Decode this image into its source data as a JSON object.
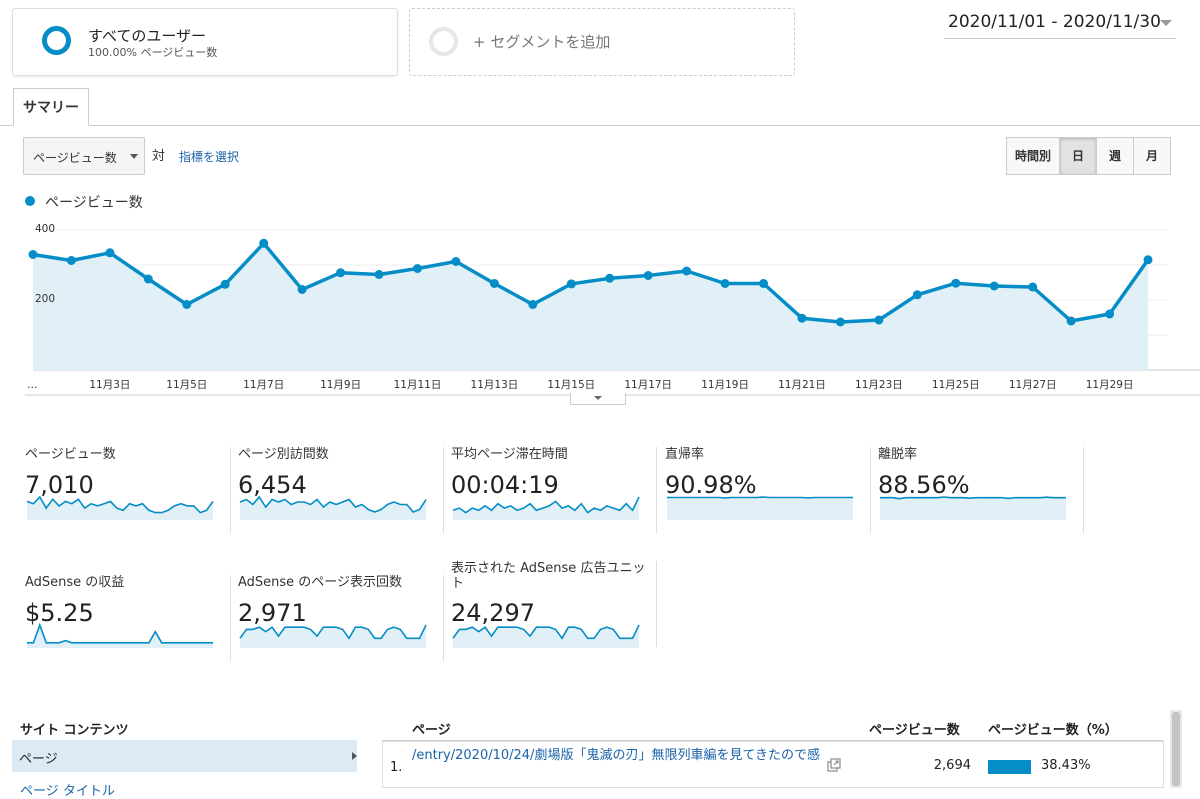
{
  "segments": {
    "all_users": {
      "title": "すべてのユーザー",
      "subtitle": "100.00% ページビュー数"
    },
    "add_label": "+ セグメントを追加"
  },
  "date_range": "2020/11/01 - 2020/11/30",
  "tab": "サマリー",
  "controls": {
    "metric": "ページビュー数",
    "vs": "対",
    "pick_metric": "指標を選択",
    "granularity": [
      "時間別",
      "日",
      "週",
      "月"
    ],
    "selected_granularity": "日"
  },
  "colors": {
    "accent": "#058dc7",
    "fill": "#e1eff7",
    "link": "#1a62a8"
  },
  "chart_data": {
    "type": "area",
    "series": [
      {
        "name": "ページビュー数",
        "values": [
          330,
          313,
          335,
          260,
          187,
          245,
          362,
          230,
          278,
          273,
          290,
          310,
          247,
          187,
          246,
          262,
          270,
          283,
          247,
          247,
          148,
          137,
          143,
          215,
          248,
          240,
          237,
          140,
          160,
          315
        ]
      }
    ],
    "x_tick_labels": [
      "…",
      "11月3日",
      "11月5日",
      "11月7日",
      "11月9日",
      "11月11日",
      "11月13日",
      "11月15日",
      "11月17日",
      "11月19日",
      "11月21日",
      "11月23日",
      "11月25日",
      "11月27日",
      "11月29日"
    ],
    "y_tick_labels": [
      "400",
      "200"
    ],
    "ylim": [
      0,
      400
    ],
    "grid": true
  },
  "cards": [
    {
      "label": "ページビュー数",
      "value": "7,010",
      "spark": [
        7,
        6,
        9,
        4,
        8,
        5,
        7,
        6,
        8,
        4,
        6,
        5,
        6,
        7,
        4,
        3,
        6,
        5,
        6,
        3,
        2,
        2,
        3,
        5,
        6,
        5,
        5,
        2,
        3,
        7
      ]
    },
    {
      "label": "ページ別訪問数",
      "value": "6,454",
      "spark": [
        6,
        7,
        5,
        8,
        4,
        7,
        6,
        7,
        5,
        6,
        6,
        5,
        7,
        4,
        6,
        5,
        6,
        7,
        4,
        5,
        3,
        2,
        3,
        5,
        6,
        5,
        5,
        2,
        3,
        7
      ]
    },
    {
      "label": "平均ページ滞在時間",
      "value": "00:04:19",
      "spark": [
        3,
        4,
        2,
        4,
        3,
        5,
        3,
        6,
        4,
        5,
        3,
        4,
        6,
        3,
        4,
        5,
        7,
        4,
        5,
        3,
        6,
        2,
        4,
        3,
        5,
        4,
        3,
        6,
        3,
        9
      ]
    },
    {
      "label": "直帰率",
      "value": "90.98%",
      "spark": [
        8,
        8,
        8,
        8,
        8,
        8,
        8,
        8,
        8,
        7.8,
        8,
        8,
        8,
        8,
        8,
        8.2,
        8,
        8,
        8,
        8,
        8,
        8,
        7.8,
        8,
        8,
        8,
        8,
        8,
        8,
        8
      ]
    },
    {
      "label": "離脱率",
      "value": "88.56%",
      "spark": [
        8,
        8,
        8,
        7.6,
        8,
        8,
        8,
        8,
        8,
        8,
        8.3,
        8,
        8,
        8,
        7.8,
        8,
        8,
        8,
        8,
        8,
        7.7,
        8,
        8,
        8,
        8,
        8,
        8.2,
        8,
        8,
        8
      ]
    },
    {
      "label": "AdSense の収益",
      "value": "$5.25",
      "spark": [
        1,
        1,
        9,
        1,
        1,
        1,
        2,
        1,
        1,
        1,
        1,
        1,
        1,
        1,
        1,
        1,
        1,
        1,
        1,
        1,
        6,
        1,
        1,
        1,
        1,
        1,
        1,
        1,
        1,
        1
      ]
    },
    {
      "label": "AdSense のページ表示回数",
      "value": "2,971",
      "spark": [
        3,
        7,
        7,
        8,
        6,
        8,
        4,
        8,
        8,
        8,
        8,
        7,
        4,
        8,
        8,
        8,
        7,
        3,
        8,
        8,
        7,
        3,
        3,
        7,
        8,
        7,
        3,
        3,
        3,
        9
      ]
    },
    {
      "label": "表示された AdSense 広告ユニット",
      "value": "24,297",
      "spark": [
        3,
        7,
        7,
        8,
        6,
        8,
        4,
        8,
        8,
        8,
        8,
        7,
        4,
        8,
        8,
        8,
        7,
        3,
        8,
        8,
        7,
        3,
        3,
        7,
        8,
        7,
        3,
        3,
        3,
        9
      ]
    }
  ],
  "site_content": {
    "title": "サイト コンテンツ",
    "selected": "ページ",
    "next_label": "ページ タイトル"
  },
  "table": {
    "headers": [
      "ページ",
      "ページビュー数",
      "ページビュー数（%）"
    ],
    "rows": [
      {
        "num": "1.",
        "page": "/entry/2020/10/24/劇場版「鬼滅の刃」無限列車編を見てきたので感",
        "views": "2,694",
        "pct": "38.43%",
        "share": 0.3843
      }
    ]
  }
}
